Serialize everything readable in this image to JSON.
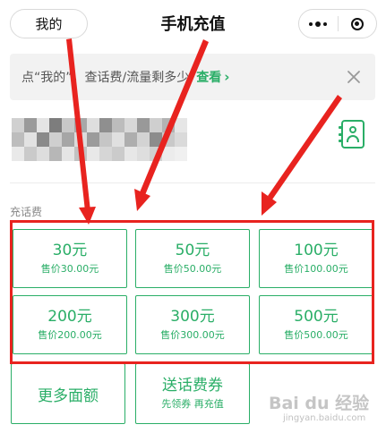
{
  "header": {
    "back_label": "我的",
    "title": "手机充值",
    "more_icon": "more-dots-icon",
    "close_icon": "target-circle-icon"
  },
  "notice": {
    "text": "点“我的”，查话费/流量剩多少",
    "link_label": "查看",
    "link_chevron": "›",
    "close_icon": "close-icon"
  },
  "phone": {
    "value_state": "blurred (pixelated)",
    "contact_icon": "contact-book-icon"
  },
  "section": {
    "label": "充话费"
  },
  "cards": [
    {
      "amount": "30元",
      "price": "售价30.00元"
    },
    {
      "amount": "50元",
      "price": "售价50.00元"
    },
    {
      "amount": "100元",
      "price": "售价100.00元"
    },
    {
      "amount": "200元",
      "price": "售价200.00元"
    },
    {
      "amount": "300元",
      "price": "售价300.00元"
    },
    {
      "amount": "500元",
      "price": "售价500.00元"
    }
  ],
  "extra_cards": [
    {
      "title": "更多面额"
    },
    {
      "title": "送话费券",
      "sub": "先领券 再充值"
    }
  ],
  "watermark": {
    "logo_text": "Bai du 经验",
    "url_text": "jingyan.baidu.com"
  },
  "colors": {
    "accent_green": "#2aae67",
    "annotation_red": "#e8231f",
    "notice_bg": "#f2f2f2"
  }
}
